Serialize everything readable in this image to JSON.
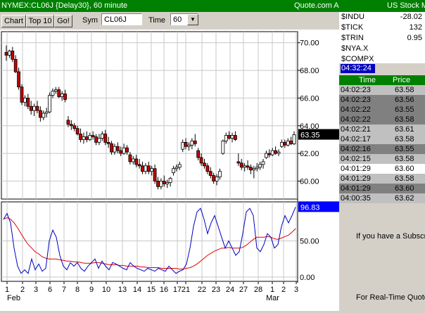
{
  "title_bar": {
    "left": "NYMEX:CL06J {Delay30}, 60 minute",
    "right": "Quote.com  A"
  },
  "toolbar": {
    "chart_label": "Chart",
    "top10_label": "Top 10",
    "go_label": "Go!",
    "sym_label": "Sym",
    "sym_value": "CL06J",
    "time_label": "Time",
    "time_value": "60",
    "dropdown_glyph": "▼"
  },
  "price_chart": {
    "y_ticks": [
      "70.00",
      "68.00",
      "66.00",
      "64.00",
      "62.00",
      "60.00"
    ],
    "last_price": "63.35",
    "ylim": [
      58.7,
      70.8
    ]
  },
  "indicator": {
    "y_ticks": [
      "50.00",
      "0.00"
    ],
    "last_value": "96.83"
  },
  "x_axis": {
    "day_labels": [
      "1",
      "2",
      "3",
      "6",
      "7",
      "8",
      "9",
      "10",
      "13",
      "14",
      "15",
      "16",
      "17",
      "21",
      "22",
      "23",
      "24",
      "27",
      "28",
      "1",
      "2",
      "3"
    ],
    "month_labels": [
      "Feb",
      "Mar"
    ]
  },
  "stock_panel": {
    "header": "US Stock M",
    "quotes": [
      {
        "symbol": "$INDU",
        "value": "-28.02"
      },
      {
        "symbol": "$TICK",
        "value": "132"
      },
      {
        "symbol": "$TRIN",
        "value": "0.95"
      },
      {
        "symbol": "$NYA.X",
        "value": ""
      },
      {
        "symbol": "$COMPX",
        "value": ""
      }
    ],
    "clock": "04:32:24"
  },
  "trades": {
    "headers": [
      "Time",
      "Price"
    ],
    "rows": [
      {
        "time": "04:02:23",
        "price": "63.58",
        "bg": "#c0c0c0"
      },
      {
        "time": "04:02:23",
        "price": "63.56",
        "bg": "#808080"
      },
      {
        "time": "04:02:22",
        "price": "63.55",
        "bg": "#808080"
      },
      {
        "time": "04:02:22",
        "price": "63.58",
        "bg": "#808080"
      },
      {
        "time": "04:02:21",
        "price": "63.61",
        "bg": "#c0c0c0"
      },
      {
        "time": "04:02:17",
        "price": "63.58",
        "bg": "#c0c0c0"
      },
      {
        "time": "04:02:16",
        "price": "63.55",
        "bg": "#808080"
      },
      {
        "time": "04:02:15",
        "price": "63.58",
        "bg": "#c0c0c0"
      },
      {
        "time": "04:01:29",
        "price": "63.60",
        "bg": "#ffffff"
      },
      {
        "time": "04:01:29",
        "price": "63.58",
        "bg": "#c0c0c0"
      },
      {
        "time": "04:01:29",
        "price": "63.60",
        "bg": "#808080"
      },
      {
        "time": "04:00:35",
        "price": "63.62",
        "bg": "#c0c0c0"
      }
    ]
  },
  "notices": {
    "subscribe": "If you have a Subscri",
    "realtime": "For Real-Time Quote"
  },
  "colors": {
    "brand_green": "#008000",
    "up_candle": "#ffffff",
    "down_candle": "#c00000",
    "price_badge": "#000000",
    "indicator_badge": "#0000ff",
    "fast_line": "#0000c0",
    "slow_line": "#e00000"
  },
  "chart_data": {
    "type": "candlestick",
    "ylim": [
      58.7,
      70.8
    ],
    "ohlc": [
      [
        69.3,
        69.8,
        68.7,
        69.1
      ],
      [
        69.1,
        69.5,
        68.9,
        69.4
      ],
      [
        69.4,
        69.7,
        68.6,
        68.8
      ],
      [
        68.8,
        69.1,
        67.8,
        67.9
      ],
      [
        67.9,
        68.2,
        66.6,
        66.8
      ],
      [
        66.8,
        67.0,
        65.5,
        65.7
      ],
      [
        65.7,
        66.2,
        65.4,
        66.0
      ],
      [
        66.0,
        66.3,
        65.2,
        65.4
      ],
      [
        65.4,
        65.8,
        64.8,
        65.1
      ],
      [
        65.1,
        65.6,
        64.7,
        65.4
      ],
      [
        65.4,
        65.8,
        64.9,
        65.1
      ],
      [
        65.1,
        65.4,
        64.3,
        64.6
      ],
      [
        64.6,
        65.1,
        64.4,
        64.9
      ],
      [
        64.9,
        65.3,
        64.6,
        65.0
      ],
      [
        65.0,
        66.4,
        64.9,
        66.2
      ],
      [
        66.2,
        66.7,
        66.0,
        66.5
      ],
      [
        66.5,
        66.8,
        66.3,
        66.6
      ],
      [
        66.6,
        66.8,
        66.0,
        66.1
      ],
      [
        66.1,
        66.5,
        65.8,
        66.3
      ],
      [
        66.3,
        66.6,
        65.7,
        65.9
      ],
      [
        64.4,
        64.7,
        63.9,
        64.1
      ],
      [
        64.1,
        64.4,
        63.7,
        64.0
      ],
      [
        64.0,
        64.2,
        63.6,
        63.8
      ],
      [
        63.8,
        64.0,
        63.3,
        63.4
      ],
      [
        63.4,
        63.8,
        62.8,
        63.0
      ],
      [
        63.0,
        63.5,
        62.7,
        63.2
      ],
      [
        63.2,
        63.6,
        62.8,
        63.0
      ],
      [
        63.0,
        63.5,
        62.9,
        63.3
      ],
      [
        63.3,
        63.6,
        63.0,
        63.2
      ],
      [
        63.2,
        63.4,
        62.6,
        62.8
      ],
      [
        62.8,
        63.4,
        62.6,
        63.1
      ],
      [
        63.1,
        63.6,
        62.9,
        63.4
      ],
      [
        63.4,
        63.7,
        62.6,
        62.8
      ],
      [
        62.8,
        63.2,
        62.4,
        62.7
      ],
      [
        62.7,
        62.9,
        61.9,
        62.1
      ],
      [
        62.1,
        62.7,
        61.9,
        62.5
      ],
      [
        62.5,
        62.8,
        62.0,
        62.2
      ],
      [
        62.2,
        62.5,
        61.8,
        62.0
      ],
      [
        62.0,
        62.7,
        61.9,
        62.4
      ],
      [
        62.4,
        62.6,
        61.9,
        62.1
      ],
      [
        61.9,
        62.1,
        61.2,
        61.4
      ],
      [
        61.4,
        61.8,
        61.2,
        61.6
      ],
      [
        61.6,
        61.9,
        61.0,
        61.2
      ],
      [
        61.2,
        61.6,
        60.9,
        61.1
      ],
      [
        61.1,
        61.4,
        60.5,
        60.7
      ],
      [
        60.7,
        61.3,
        60.5,
        61.1
      ],
      [
        61.1,
        61.4,
        60.5,
        60.7
      ],
      [
        60.7,
        61.1,
        60.4,
        60.9
      ],
      [
        60.9,
        61.2,
        59.8,
        60.0
      ],
      [
        60.0,
        60.3,
        59.4,
        59.6
      ],
      [
        59.6,
        60.2,
        59.4,
        60.0
      ],
      [
        60.0,
        60.4,
        59.6,
        59.8
      ],
      [
        59.8,
        60.1,
        59.5,
        59.9
      ],
      [
        59.9,
        60.3,
        59.6,
        60.2
      ],
      [
        60.6,
        61.1,
        60.4,
        60.9
      ],
      [
        60.9,
        61.2,
        60.7,
        61.0
      ],
      [
        61.0,
        61.4,
        60.8,
        61.2
      ],
      [
        62.3,
        63.0,
        62.1,
        62.8
      ],
      [
        62.8,
        63.1,
        62.3,
        62.5
      ],
      [
        62.5,
        62.8,
        62.2,
        62.6
      ],
      [
        62.6,
        63.1,
        62.3,
        62.9
      ],
      [
        62.9,
        63.4,
        62.5,
        62.7
      ],
      [
        62.2,
        62.4,
        61.5,
        61.7
      ],
      [
        61.7,
        62.0,
        61.1,
        61.3
      ],
      [
        61.3,
        61.6,
        60.9,
        61.1
      ],
      [
        61.1,
        61.3,
        60.5,
        60.7
      ],
      [
        60.7,
        61.0,
        60.2,
        60.4
      ],
      [
        60.4,
        60.6,
        59.8,
        60.0
      ],
      [
        60.0,
        60.5,
        59.7,
        60.3
      ],
      [
        60.3,
        60.9,
        60.1,
        60.7
      ],
      [
        62.0,
        63.0,
        61.9,
        62.9
      ],
      [
        62.9,
        63.5,
        62.7,
        63.3
      ],
      [
        63.3,
        63.6,
        63.0,
        63.1
      ],
      [
        63.1,
        63.5,
        62.8,
        63.3
      ],
      [
        63.3,
        63.6,
        62.9,
        63.0
      ],
      [
        61.4,
        62.0,
        61.1,
        61.3
      ],
      [
        61.3,
        61.6,
        60.8,
        61.0
      ],
      [
        61.0,
        61.3,
        60.7,
        61.1
      ],
      [
        61.1,
        61.5,
        60.8,
        61.0
      ],
      [
        61.0,
        61.2,
        60.5,
        60.8
      ],
      [
        60.8,
        61.1,
        60.2,
        60.9
      ],
      [
        60.9,
        61.3,
        60.7,
        61.0
      ],
      [
        61.0,
        61.4,
        60.8,
        61.2
      ],
      [
        61.2,
        61.6,
        60.9,
        61.4
      ],
      [
        61.7,
        62.2,
        61.6,
        62.0
      ],
      [
        62.0,
        62.3,
        61.7,
        61.9
      ],
      [
        61.9,
        62.4,
        61.8,
        62.2
      ],
      [
        62.2,
        62.5,
        61.9,
        62.0
      ],
      [
        62.0,
        62.3,
        61.8,
        62.1
      ],
      [
        62.5,
        63.0,
        62.4,
        62.8
      ],
      [
        62.8,
        63.0,
        62.4,
        62.6
      ],
      [
        62.6,
        63.1,
        62.5,
        62.9
      ],
      [
        62.9,
        63.2,
        62.6,
        62.7
      ],
      [
        62.7,
        63.6,
        62.6,
        63.35
      ]
    ],
    "indicator": {
      "ylim": [
        -6,
        104
      ],
      "fast": [
        80,
        88,
        75,
        40,
        15,
        5,
        10,
        5,
        25,
        10,
        18,
        8,
        12,
        50,
        65,
        55,
        30,
        15,
        10,
        20,
        15,
        20,
        12,
        8,
        15,
        20,
        25,
        12,
        22,
        15,
        10,
        20,
        18,
        15,
        12,
        10,
        20,
        15,
        12,
        10,
        8,
        12,
        10,
        8,
        12,
        10,
        8,
        15,
        10,
        5,
        8,
        10,
        18,
        40,
        70,
        90,
        95,
        80,
        60,
        75,
        85,
        70,
        55,
        40,
        50,
        40,
        30,
        35,
        60,
        90,
        95,
        85,
        40,
        35,
        45,
        60,
        55,
        40,
        45,
        70,
        85,
        75,
        85,
        96.83
      ],
      "slow": [
        80,
        82,
        80,
        75,
        68,
        60,
        52,
        45,
        40,
        35,
        32,
        28,
        26,
        25,
        25,
        25,
        24,
        23,
        22,
        22,
        21,
        21,
        20,
        19,
        19,
        19,
        20,
        20,
        19,
        18,
        17,
        17,
        17,
        16,
        16,
        15,
        15,
        15,
        15,
        14,
        14,
        13,
        13,
        13,
        13,
        12,
        12,
        12,
        12,
        12,
        11,
        11,
        12,
        13,
        15,
        18,
        22,
        26,
        30,
        33,
        36,
        38,
        40,
        40,
        41,
        40,
        40,
        40,
        41,
        44,
        48,
        52,
        55,
        55,
        55,
        56,
        55,
        53,
        52,
        54,
        56,
        58,
        62,
        67
      ]
    }
  }
}
